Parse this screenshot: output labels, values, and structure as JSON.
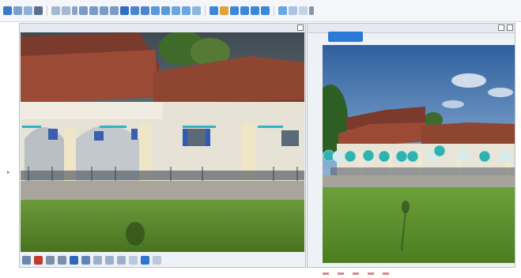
{
  "toolbar": {
    "icons": [
      "cursor-icon",
      "pan-icon",
      "zoom-icon",
      "measure-icon",
      "point-icon",
      "line-icon",
      "polygon-icon",
      "sphere-icon",
      "settings-icon",
      "export-icon",
      "undo-icon",
      "redo-icon"
    ]
  },
  "left_view": {
    "title": "",
    "buttons": 4
  },
  "right_view": {
    "title": "",
    "nav_label": ""
  },
  "colors": {
    "accent": "#2b79d6",
    "sphere": "#2fb3b0",
    "toolbar_bg": "#f4f6f9"
  }
}
